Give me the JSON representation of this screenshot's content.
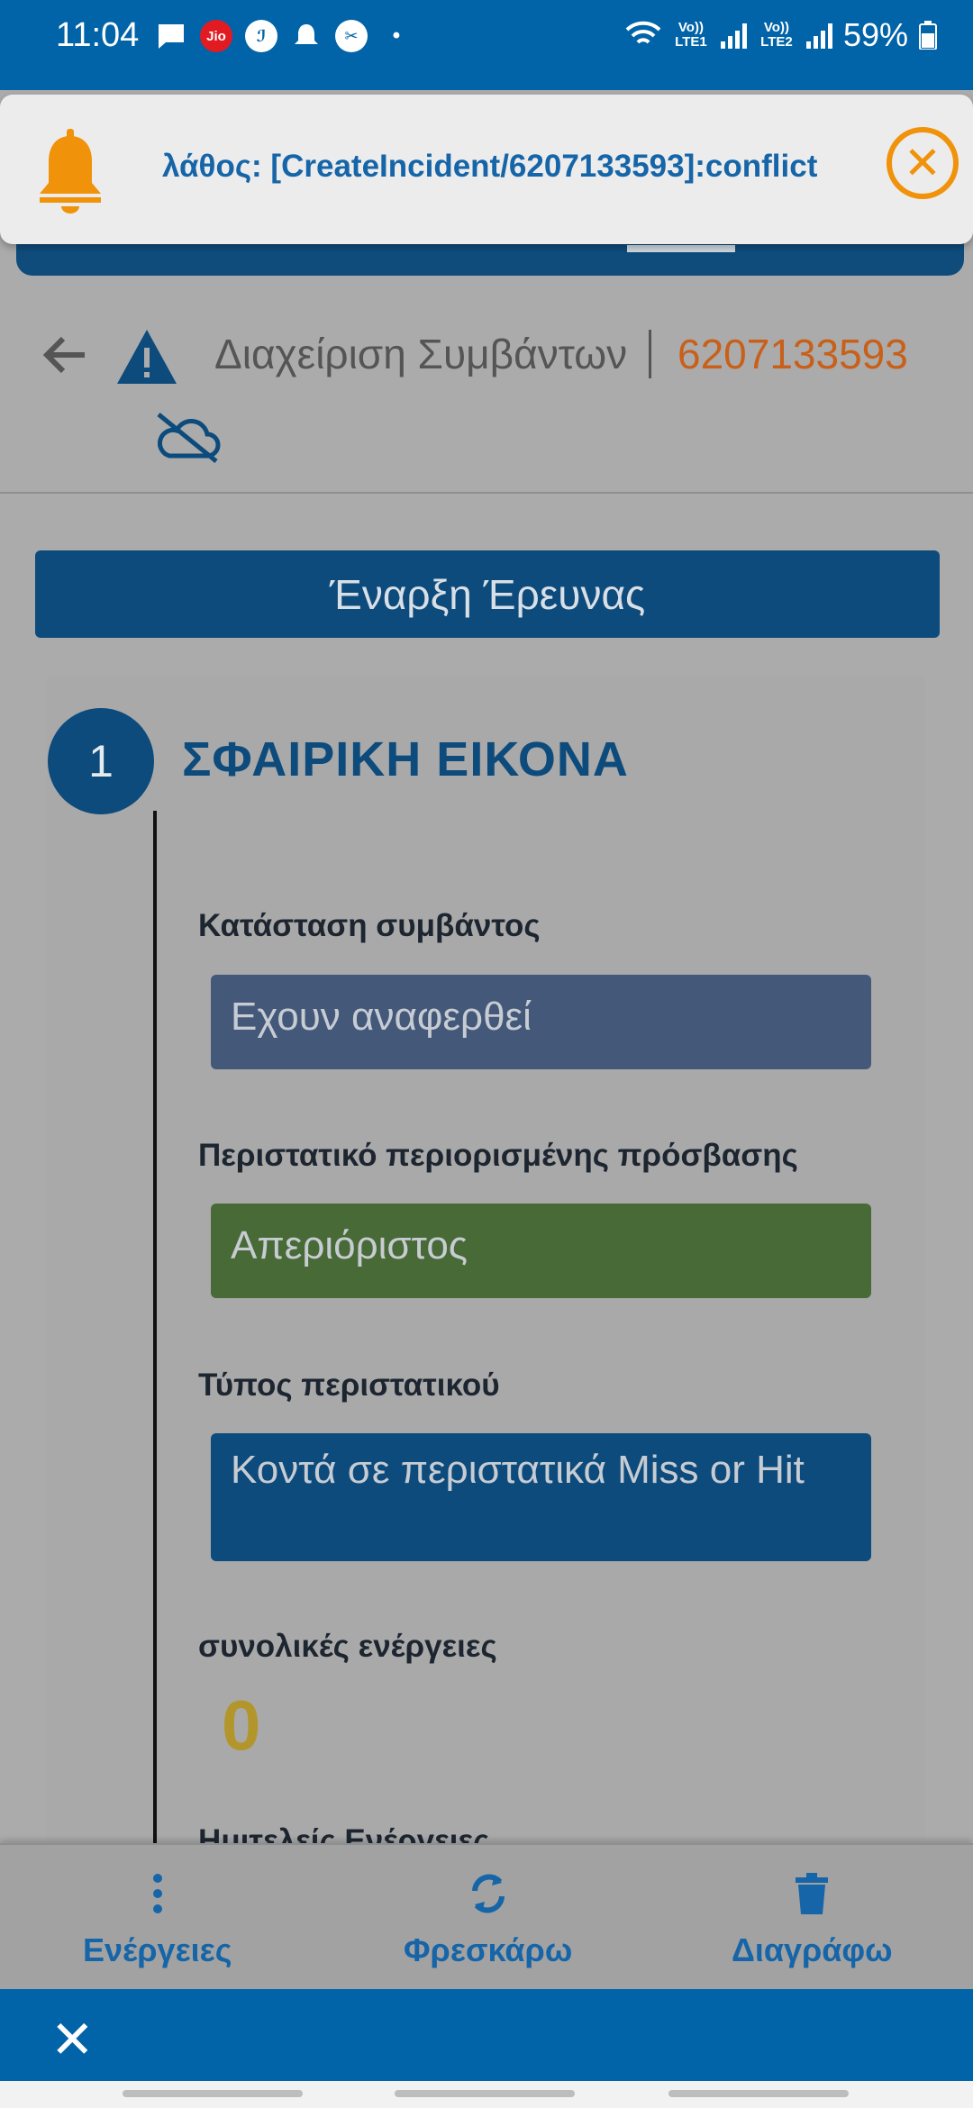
{
  "status_bar": {
    "time": "11:04",
    "battery": "59%",
    "sim1": "Vo)) LTE1",
    "sim2": "Vo)) LTE2",
    "icons": [
      "message-icon",
      "jio-icon",
      "app-icon",
      "notification-icon",
      "settings-icon",
      "dot-icon",
      "wifi-icon",
      "signal-icon",
      "battery-icon"
    ]
  },
  "notification": {
    "message": "λάθος: [CreateIncident/6207133593]:conflict",
    "accent": "#f0920a"
  },
  "header": {
    "title": "Διαχείριση Συμβάντων",
    "incident_id": "6207133593"
  },
  "start_button": {
    "label": "Έναρξη Έρευνας"
  },
  "step": {
    "number": "1",
    "title": "ΣΦΑΙΡΙΚΗ ΕΙΚΟΝΑ"
  },
  "fields": {
    "status_label": "Κατάσταση συμβάντος",
    "status_value": "Εχουν αναφερθεί",
    "access_label": "Περιστατικό περιορισμένης πρόσβασης",
    "access_value": "Απεριόριστος",
    "type_label": "Τύπος περιστατικού",
    "type_value": "Κοντά σε περιστατικά Miss or Hit",
    "total_label": "συνολικές ενέργειες",
    "total_value": "0",
    "partial_label": "Ημιτελείς Ενέργειες"
  },
  "colors": {
    "primary": "#0264a8",
    "status_box": "#44587a",
    "access_box": "#486a36",
    "type_box": "#0d4b7c",
    "id_orange": "#c8601a"
  },
  "actions": {
    "actions_label": "Ενέργειες",
    "refresh_label": "Φρεσκάρω",
    "delete_label": "Διαγράφω"
  }
}
